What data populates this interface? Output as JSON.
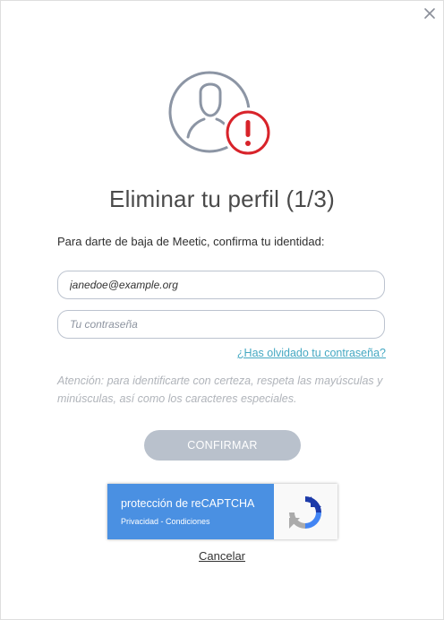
{
  "dialog": {
    "title": "Eliminar tu perfil (1/3)",
    "subtitle": "Para darte de baja de Meetic, confirma tu identidad:",
    "email_value": "janedoe@example.org",
    "password_placeholder": "Tu contraseña",
    "forgot_link": "¿Has olvidado tu contraseña?",
    "note": "Atención: para identificarte con certeza, respeta las mayúsculas y minúsculas, así como los caracteres especiales.",
    "confirm_label": "CONFIRMAR",
    "cancel_label": "Cancelar"
  },
  "recaptcha": {
    "title": "protección de reCAPTCHA",
    "privacy": "Privacidad",
    "separator": " - ",
    "terms": "Condiciones"
  },
  "icons": {
    "close": "close-icon",
    "profile": "user-profile-icon",
    "warning": "warning-exclamation-icon",
    "recaptcha": "recaptcha-logo-icon"
  },
  "colors": {
    "warning_red": "#d8232a",
    "icon_gray": "#8c95a4",
    "link_blue": "#46a9c3",
    "button_disabled": "#b9c1cc",
    "recaptcha_blue": "#4a90e2"
  }
}
